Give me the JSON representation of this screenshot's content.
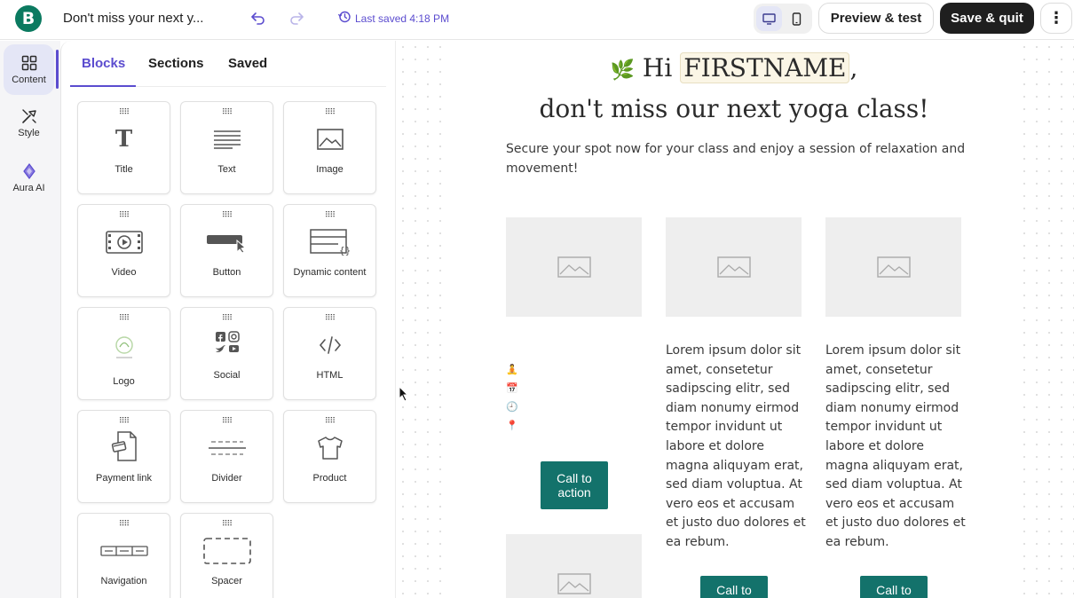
{
  "header": {
    "logo_letter": "B",
    "doc_title": "Don't miss your next y...",
    "last_saved": "Last saved 4:18 PM",
    "preview_label": "Preview & test",
    "save_label": "Save & quit",
    "more_label": "⋮"
  },
  "rail": {
    "items": [
      {
        "label": "Content",
        "icon": "grid-icon"
      },
      {
        "label": "Style",
        "icon": "brush-icon"
      },
      {
        "label": "Aura AI",
        "icon": "sparkle-icon"
      }
    ]
  },
  "panel": {
    "tabs": [
      "Blocks",
      "Sections",
      "Saved"
    ],
    "blocks": [
      {
        "label": "Title",
        "icon": "title-icon"
      },
      {
        "label": "Text",
        "icon": "text-icon"
      },
      {
        "label": "Image",
        "icon": "image-icon"
      },
      {
        "label": "Video",
        "icon": "video-icon"
      },
      {
        "label": "Button",
        "icon": "button-icon"
      },
      {
        "label": "Dynamic content",
        "icon": "dynamic-content-icon"
      },
      {
        "label": "Logo",
        "icon": "logo-icon"
      },
      {
        "label": "Social",
        "icon": "social-icon"
      },
      {
        "label": "HTML",
        "icon": "html-icon"
      },
      {
        "label": "Payment link",
        "icon": "payment-link-icon"
      },
      {
        "label": "Divider",
        "icon": "divider-icon"
      },
      {
        "label": "Product",
        "icon": "product-icon"
      },
      {
        "label": "Navigation",
        "icon": "navigation-icon"
      },
      {
        "label": "Spacer",
        "icon": "spacer-icon"
      }
    ]
  },
  "email": {
    "greeting_emoji": "🌿",
    "greeting_prefix": "Hi",
    "first_name_tag": "FIRSTNAME",
    "greeting_suffix": ",",
    "headline": "don't miss our next yoga class!",
    "intro": "Secure your spot now for your class and enjoy a session of relaxation and movement!",
    "column_text": "Lorem ipsum dolor sit amet, consetetur sadipscing elitr, sed diam nonumy eirmod tempor invidunt ut labore et dolore magna aliquyam erat, sed diam voluptua. At vero eos et accusam et justo duo dolores et ea rebum.",
    "emoji_list": [
      "🧘",
      "📅",
      "🕘",
      "📍"
    ],
    "cta_label": "Call to action",
    "cta_partial": "Call to"
  },
  "colors": {
    "brand_green": "#0b7a60",
    "accent_purple": "#5b4ccf",
    "cta_teal": "#13726b"
  }
}
